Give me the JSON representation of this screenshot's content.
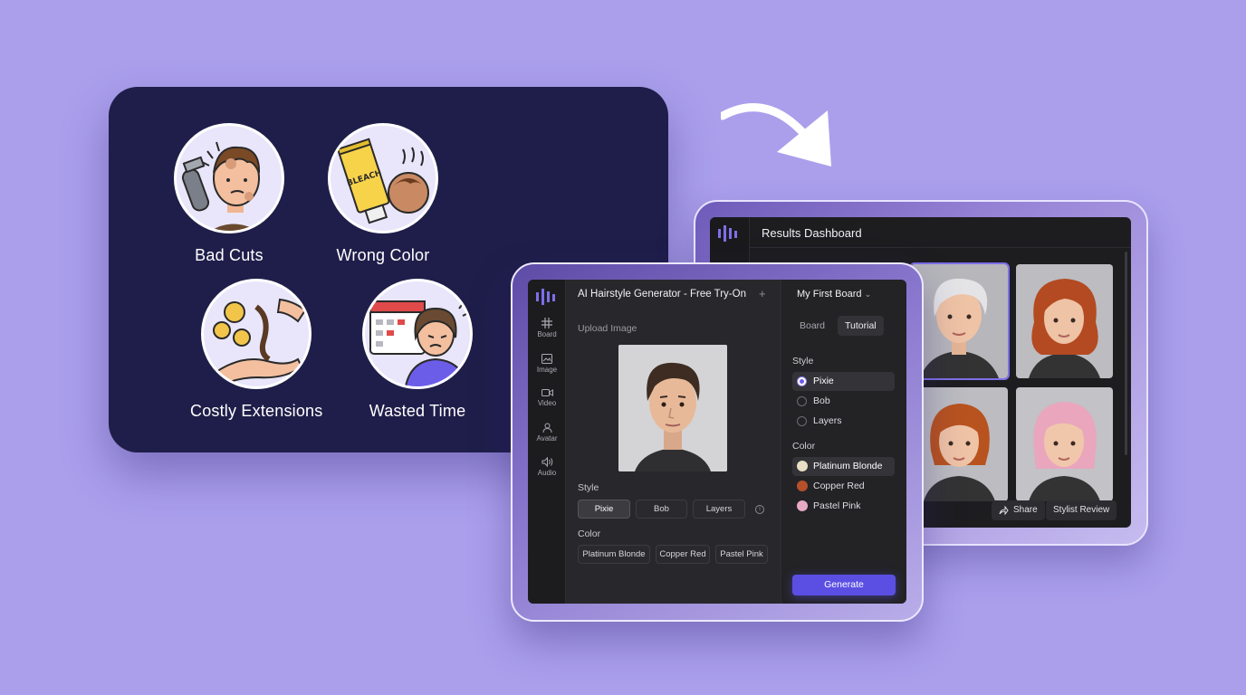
{
  "problems": {
    "items": [
      {
        "label": "Bad Cuts",
        "icon": "clipper-bad-haircut-icon"
      },
      {
        "label": "Wrong Color",
        "icon": "bleach-tube-icon",
        "tube_text": "BLEACH"
      },
      {
        "label": "Costly Extensions",
        "icon": "coins-hair-extension-icon"
      },
      {
        "label": "Wasted Time",
        "icon": "calendar-stressed-person-icon"
      }
    ]
  },
  "results": {
    "title": "Results Dashboard",
    "share_label": "Share",
    "review_label": "Stylist Review",
    "thumbnails": [
      {
        "hair": "Platinum Blonde Pixie",
        "color": "#d9d9dc",
        "selected": true
      },
      {
        "hair": "Copper Red Layers",
        "color": "#b44a22",
        "selected": false
      },
      {
        "hair": "Copper Red Bob",
        "color": "#b8531f",
        "selected": false
      },
      {
        "hair": "Pastel Pink Bob",
        "color": "#e9a6bd",
        "selected": false
      }
    ]
  },
  "generator": {
    "title": "AI Hairstyle Generator - Free Try-On",
    "nav": [
      "Board",
      "Image",
      "Video",
      "Avatar",
      "Audio"
    ],
    "upload_label": "Upload Image",
    "style_label": "Style",
    "style_chips": [
      "Pixie",
      "Bob",
      "Layers"
    ],
    "color_label": "Color",
    "color_chips": [
      "Platinum Blonde",
      "Copper Red",
      "Pastel Pink"
    ],
    "board_name": "My First Board",
    "tabs": [
      "Board",
      "Tutorial"
    ],
    "right_style_label": "Style",
    "style_options": [
      "Pixie",
      "Bob",
      "Layers"
    ],
    "right_color_label": "Color",
    "color_options": [
      {
        "label": "Platinum Blonde",
        "swatch": "#e8dfc4"
      },
      {
        "label": "Copper Red",
        "swatch": "#b4502a"
      },
      {
        "label": "Pastel Pink",
        "swatch": "#e9a9c2"
      }
    ],
    "generate_label": "Generate",
    "accent": "#5b4fe3"
  }
}
